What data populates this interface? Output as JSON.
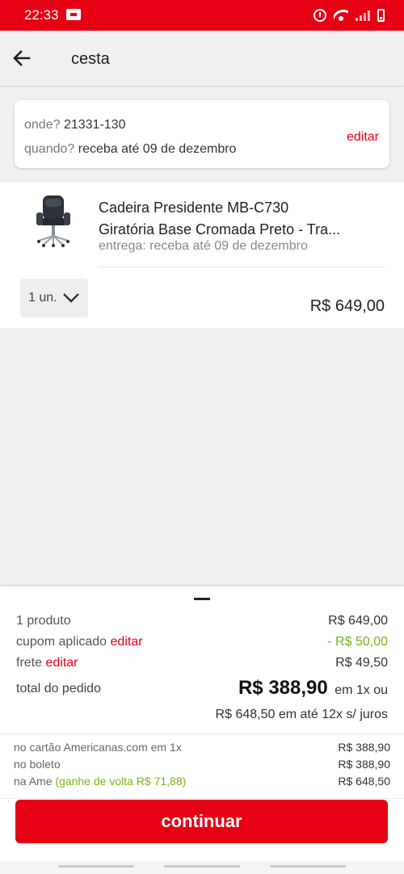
{
  "status_bar": {
    "time": "22:33",
    "icons": [
      "app-notification-icon",
      "alarm-icon",
      "wifi-icon",
      "signal-icon",
      "battery-icon"
    ]
  },
  "header": {
    "title": "cesta",
    "back_icon": "arrow-left-icon"
  },
  "delivery": {
    "where_label": "onde?",
    "where_value": "21331-130",
    "when_label": "quando?",
    "when_value": "receba até 09 de dezembro",
    "edit_label": "editar"
  },
  "product": {
    "name_line1": "Cadeira Presidente MB-C730",
    "name_line2": "Giratória Base Cromada Preto - Tra...",
    "delivery": "entrega: receba até 09 de dezembro",
    "quantity": "1 un.",
    "price": "R$ 649,00"
  },
  "summary": {
    "products_label": "1 produto",
    "products_value": "R$ 649,00",
    "coupon_label": "cupom aplicado",
    "coupon_edit": "editar",
    "coupon_value": "- R$ 50,00",
    "shipping_label": "frete",
    "shipping_edit": "editar",
    "shipping_value": "R$ 49,50",
    "total_label": "total do pedido",
    "total_value": "R$ 388,90",
    "total_suffix": "em 1x ou",
    "installments": "R$ 648,50 em até 12x s/ juros",
    "payment": [
      {
        "label": "no cartão Americanas.com em 1x",
        "note": "",
        "value": "R$ 388,90"
      },
      {
        "label": "no boleto",
        "note": "",
        "value": "R$ 388,90"
      },
      {
        "label": "na Ame",
        "note": "(ganhe de volta R$ 71,88)",
        "value": "R$ 648,50"
      }
    ],
    "continue_label": "continuar"
  },
  "colors": {
    "brand_red": "#e60014",
    "cashback_green": "#7ab317"
  }
}
